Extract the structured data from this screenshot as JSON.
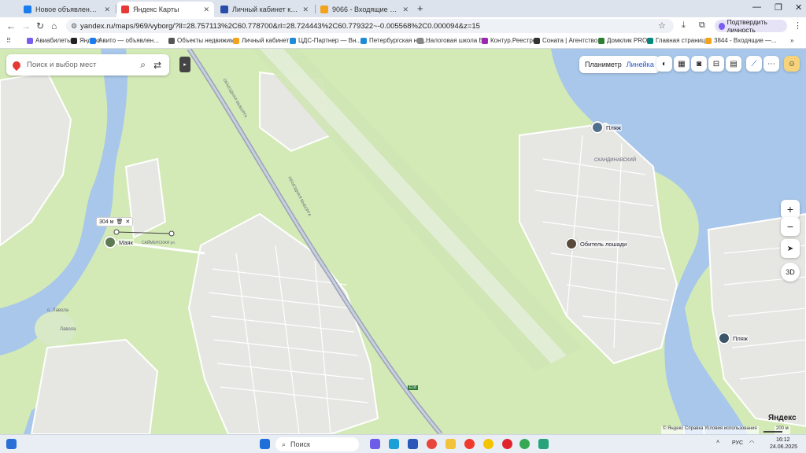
{
  "browser": {
    "tabs": [
      {
        "title": "Новое объявление — Объявл...",
        "color": "#1a7cf0",
        "active": false
      },
      {
        "title": "Яндекс Карты",
        "color": "#e53935",
        "active": true
      },
      {
        "title": "Личный кабинет клиента",
        "color": "#2a4ea8",
        "active": false
      },
      {
        "title": "9066 - Входящие — Яндекс П...",
        "color": "#f2a31a",
        "active": false
      }
    ],
    "newtab": "+",
    "url": "yandex.ru/maps/969/vyborg/?ll=28.757113%2C60.778700&rl=28.724443%2C60.779322~-0.005568%2C0.000094&z=15",
    "verify_label": "Подтвердить личность",
    "bookmarks": [
      {
        "label": "Авиабилеты",
        "color": "#7a5cf0"
      },
      {
        "label": "Яндекс",
        "color": "#222222"
      },
      {
        "label": "Авито — объявлен...",
        "color": "#1a7cf0"
      },
      {
        "label": "Объекты недвижим...",
        "color": "#555555"
      },
      {
        "label": "Личный кабинет",
        "color": "#f2a31a"
      },
      {
        "label": "ЦДС-Партнер — Вн...",
        "color": "#1e8bd8"
      },
      {
        "label": "Петербургская нед...",
        "color": "#1e8bd8"
      },
      {
        "label": "Налоговая школа Б...",
        "color": "#888888"
      },
      {
        "label": "Контур.Реестро",
        "color": "#9c27b0"
      },
      {
        "label": "Соната | Агентство...",
        "color": "#333333"
      },
      {
        "label": "Домклик PRO",
        "color": "#2e7d32"
      },
      {
        "label": "Главная страница",
        "color": "#00897b"
      },
      {
        "label": "3844 - Входящие —...",
        "color": "#f2a31a"
      }
    ]
  },
  "map": {
    "search_placeholder": "Поиск и выбор мест",
    "controls": {
      "planimeter": "Планиметр",
      "ruler": "Линейка",
      "mode_3d": "3D",
      "zoom_in": "+",
      "zoom_out": "−"
    },
    "ruler_badge": "304 м",
    "pois": {
      "mayak": "Маяк",
      "obitel": "Обитель лошади",
      "plyazh_top": "Пляж",
      "plyazh_right": "Пляж"
    },
    "labels": {
      "road_east": "ОБЪЕЗДНАЯ ВЫБОРГА",
      "road_east_2": "ОБЪЕЗДНАЯ ВЫБОРГА",
      "o_lavola": "о. Лавола",
      "lavola": "Лавола",
      "skandinavsky": "СКАНДИНАВСКИЙ",
      "e18": "E18",
      "sayminskaya": "САЙМЕНСКАЯ ул."
    },
    "logo": "Яндекс",
    "footer": [
      "© Яндекс",
      "Справка",
      "Условия использования"
    ],
    "scale": "200 м"
  },
  "taskbar": {
    "search_label": "Поиск",
    "lang": "РУС",
    "time": "16:12",
    "date": "24.06.2025"
  }
}
